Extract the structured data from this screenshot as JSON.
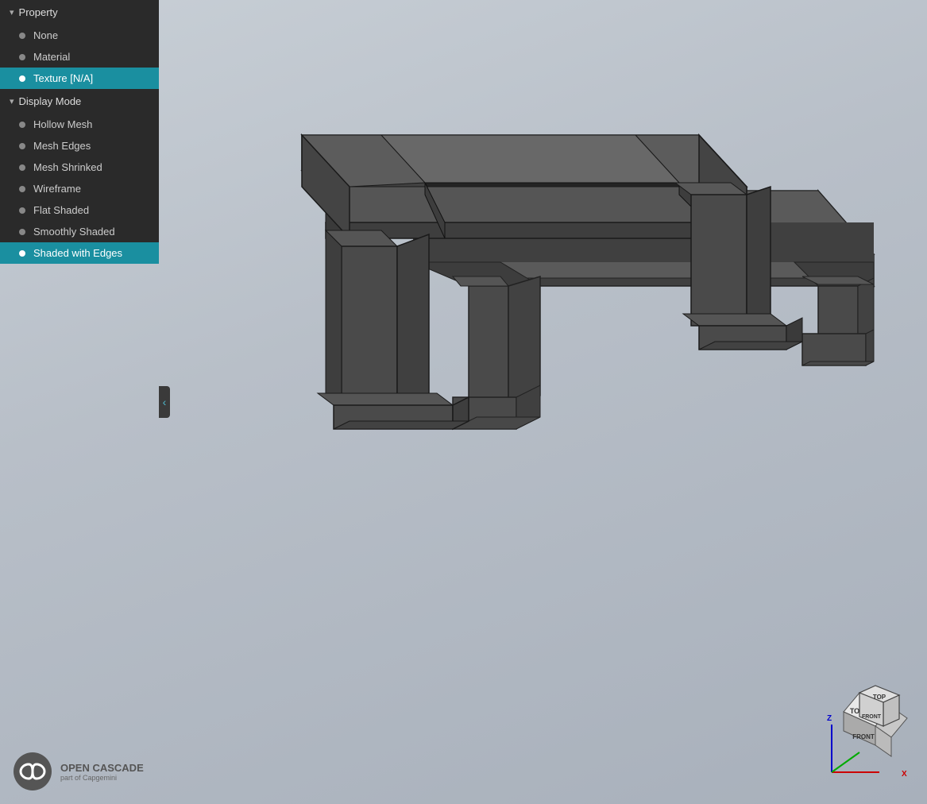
{
  "panel": {
    "property_section": {
      "label": "Property",
      "arrow": "▾"
    },
    "property_items": [
      {
        "id": "none",
        "label": "None",
        "active": false
      },
      {
        "id": "material",
        "label": "Material",
        "active": false
      },
      {
        "id": "texture",
        "label": "Texture [N/A]",
        "active": true
      }
    ],
    "display_mode_section": {
      "label": "Display Mode",
      "arrow": "▾"
    },
    "display_mode_items": [
      {
        "id": "hollow-mesh",
        "label": "Hollow Mesh",
        "active": false
      },
      {
        "id": "mesh-edges",
        "label": "Mesh Edges",
        "active": false
      },
      {
        "id": "mesh-shrinked",
        "label": "Mesh Shrinked",
        "active": false
      },
      {
        "id": "wireframe",
        "label": "Wireframe",
        "active": false
      },
      {
        "id": "flat-shaded",
        "label": "Flat Shaded",
        "active": false
      },
      {
        "id": "smoothly-shaded",
        "label": "Smoothly Shaded",
        "active": false
      },
      {
        "id": "shaded-with-edges",
        "label": "Shaded with Edges",
        "active": true
      }
    ]
  },
  "nav_cube": {
    "top_label": "TOP",
    "front_label": "FRONT"
  },
  "logo": {
    "name": "OPEN CASCADE",
    "sub": "part of Capgemini"
  },
  "collapse_handle": "‹"
}
